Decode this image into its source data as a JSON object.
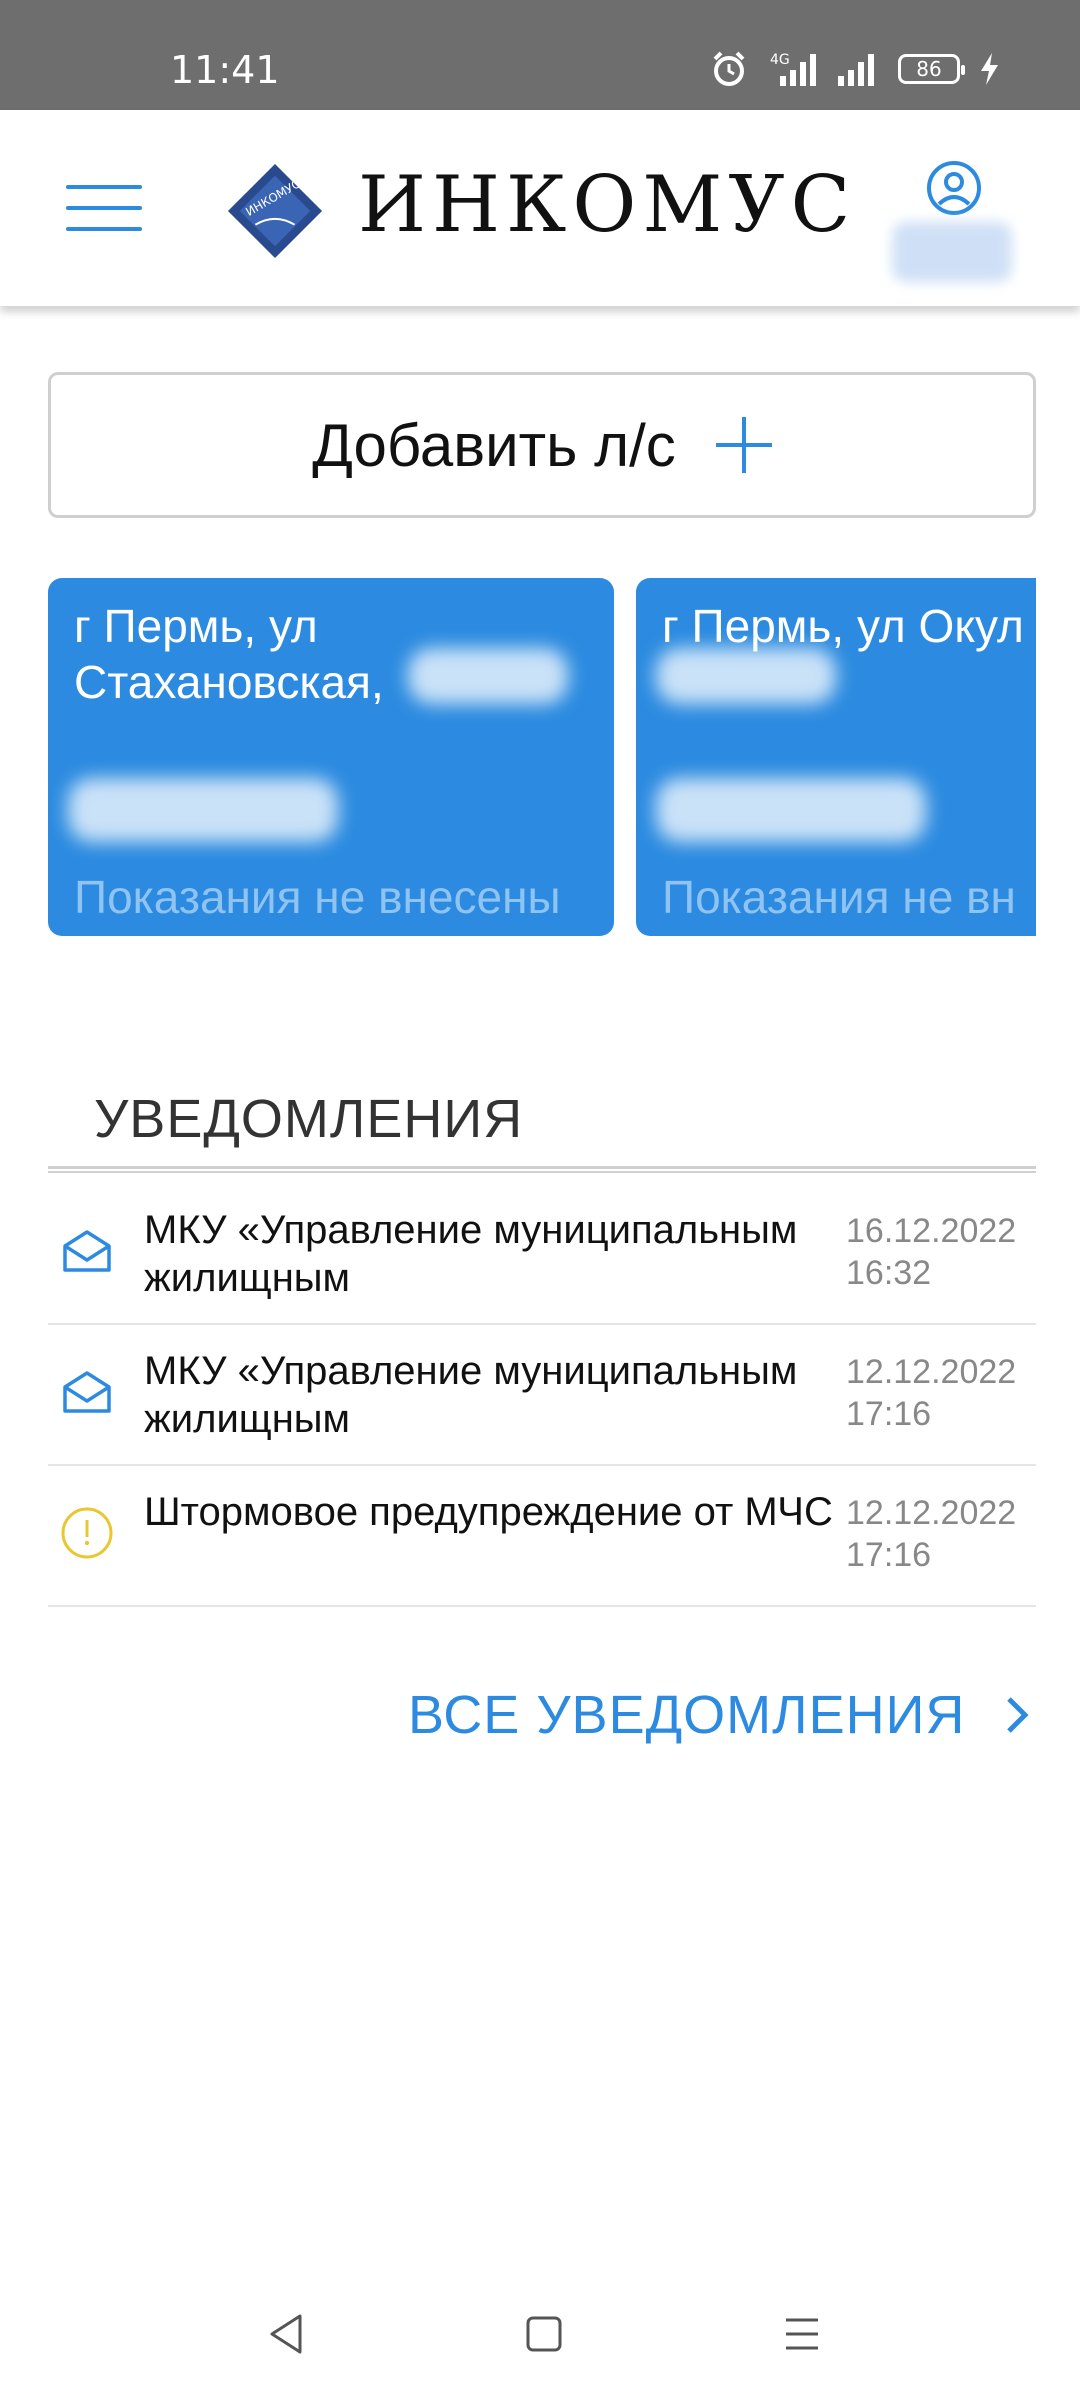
{
  "status_bar": {
    "time": "11:41",
    "battery": "86",
    "network": "4G",
    "icons": [
      "alarm-icon",
      "signal-icon",
      "signal-icon",
      "battery-icon",
      "charging-icon"
    ]
  },
  "header": {
    "brand": "ИНКОМУС",
    "logo_text": "ИНКОМУС",
    "icons": [
      "menu-icon",
      "logo",
      "profile-icon"
    ]
  },
  "add_account": {
    "label": "Добавить л/с",
    "icon": "plus-icon"
  },
  "accounts": [
    {
      "address": "г Пермь, ул Стахановская,",
      "status": "Показания не внесены"
    },
    {
      "address": "г Пермь, ул Окул",
      "status": "Показания не вн"
    }
  ],
  "notifications": {
    "title": "УВЕДОМЛЕНИЯ",
    "items": [
      {
        "text": "МКУ «Управление муниципальным жилищным",
        "date": "16.12.2022",
        "time": "16:32",
        "icon": "envelope-open-icon"
      },
      {
        "text": "МКУ «Управление муниципальным жилищным",
        "date": "12.12.2022",
        "time": "17:16",
        "icon": "envelope-open-icon"
      },
      {
        "text": "Штормовое предупреждение от МЧС",
        "date": "12.12.2022",
        "time": "17:16",
        "icon": "warning-icon"
      }
    ],
    "all_label": "ВСЕ УВЕДОМЛЕНИЯ",
    "all_icon": "chevron-right-icon"
  },
  "colors": {
    "accent": "#2c8be0",
    "warning": "#e8c730",
    "card_status": "#8ec3f2"
  },
  "nav_bar": {
    "icons": [
      "back-icon",
      "home-icon",
      "recents-icon"
    ]
  }
}
